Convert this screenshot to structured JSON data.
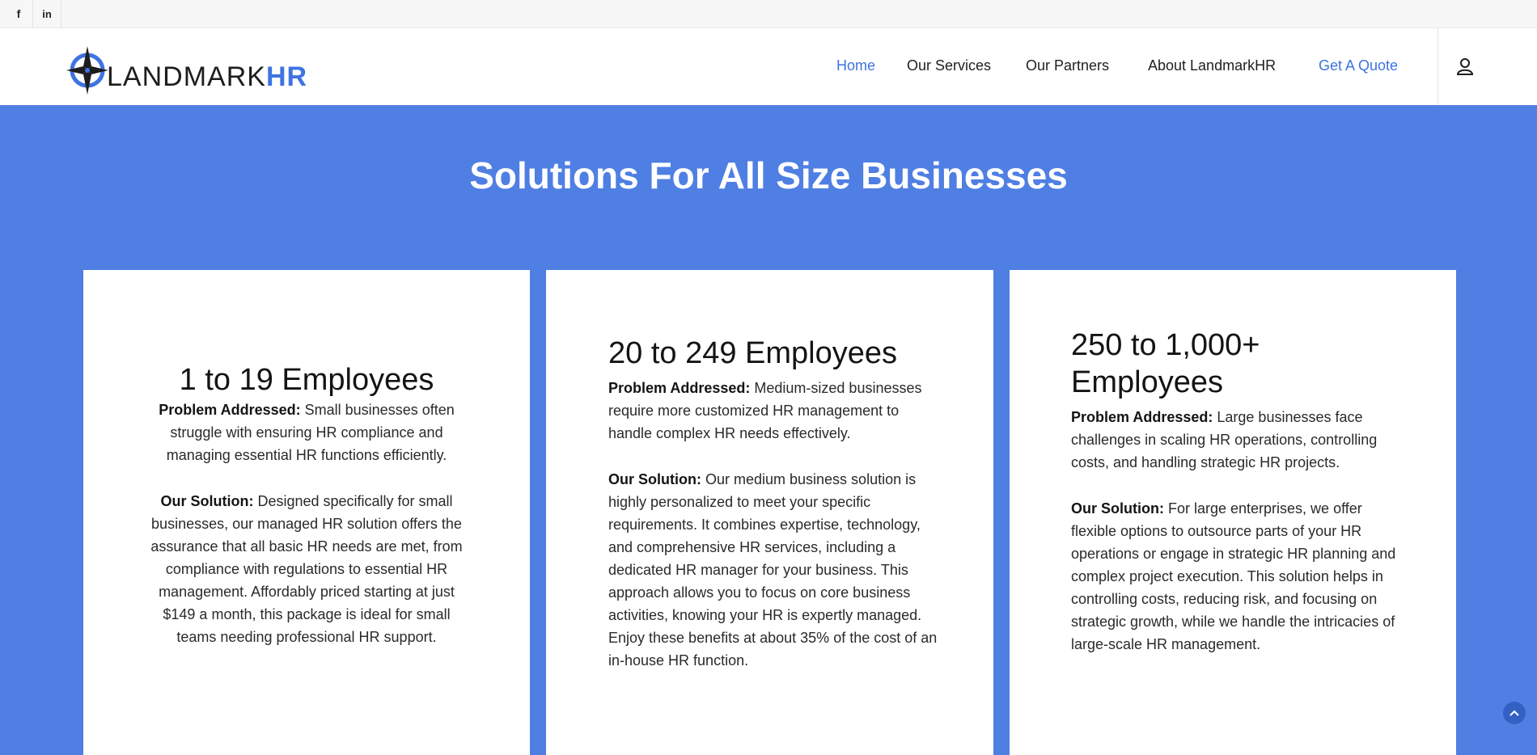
{
  "social": {
    "facebook_glyph": "f",
    "linkedin_glyph": "in"
  },
  "header": {
    "logo_text_main": "LANDMARK",
    "logo_text_accent": "HR",
    "nav": [
      {
        "label": "Home"
      },
      {
        "label": "Our Services"
      },
      {
        "label": "Our Partners"
      },
      {
        "label": "About LandmarkHR"
      },
      {
        "label": "Get A Quote"
      }
    ]
  },
  "hero": {
    "title": "Solutions For All Size Businesses"
  },
  "cards": [
    {
      "title": "1 to 19 Employees",
      "problem_label": "Problem Addressed:",
      "problem_text": " Small businesses often struggle with ensuring HR compliance and managing essential HR functions efficiently.",
      "solution_label": "Our Solution:",
      "solution_text": " Designed specifically for small businesses, our managed HR solution offers the assurance that all basic HR needs are met, from compliance with regulations to essential HR management. Affordably priced starting at just $149 a month, this package is ideal for small teams needing professional HR support."
    },
    {
      "title": "20 to 249 Employees",
      "problem_label": "Problem Addressed:",
      "problem_text": " Medium-sized businesses require more customized HR management to handle complex HR needs effectively.",
      "solution_label": "Our Solution:",
      "solution_text": " Our medium business solution is highly personalized to meet your specific requirements. It combines expertise, technology, and comprehensive HR services, including a dedicated HR manager for your business. This approach allows you to focus on core business activities, knowing your HR is expertly managed. Enjoy these benefits at about 35% of the cost of an in-house HR function."
    },
    {
      "title": "250 to 1,000+ Employees",
      "problem_label": "Problem Addressed:",
      "problem_text": " Large businesses face challenges in scaling HR operations, controlling costs, and handling strategic HR projects.",
      "solution_label": "Our Solution:",
      "solution_text": " For large enterprises, we offer flexible options to outsource parts of your HR operations or engage in strategic HR planning and complex project execution. This solution helps in controlling costs, reducing risk, and focusing on strategic growth, while we handle the intricacies of large-scale HR management."
    }
  ],
  "colors": {
    "brand_blue": "#3e73e1",
    "hero_background": "#4f7fe3"
  }
}
